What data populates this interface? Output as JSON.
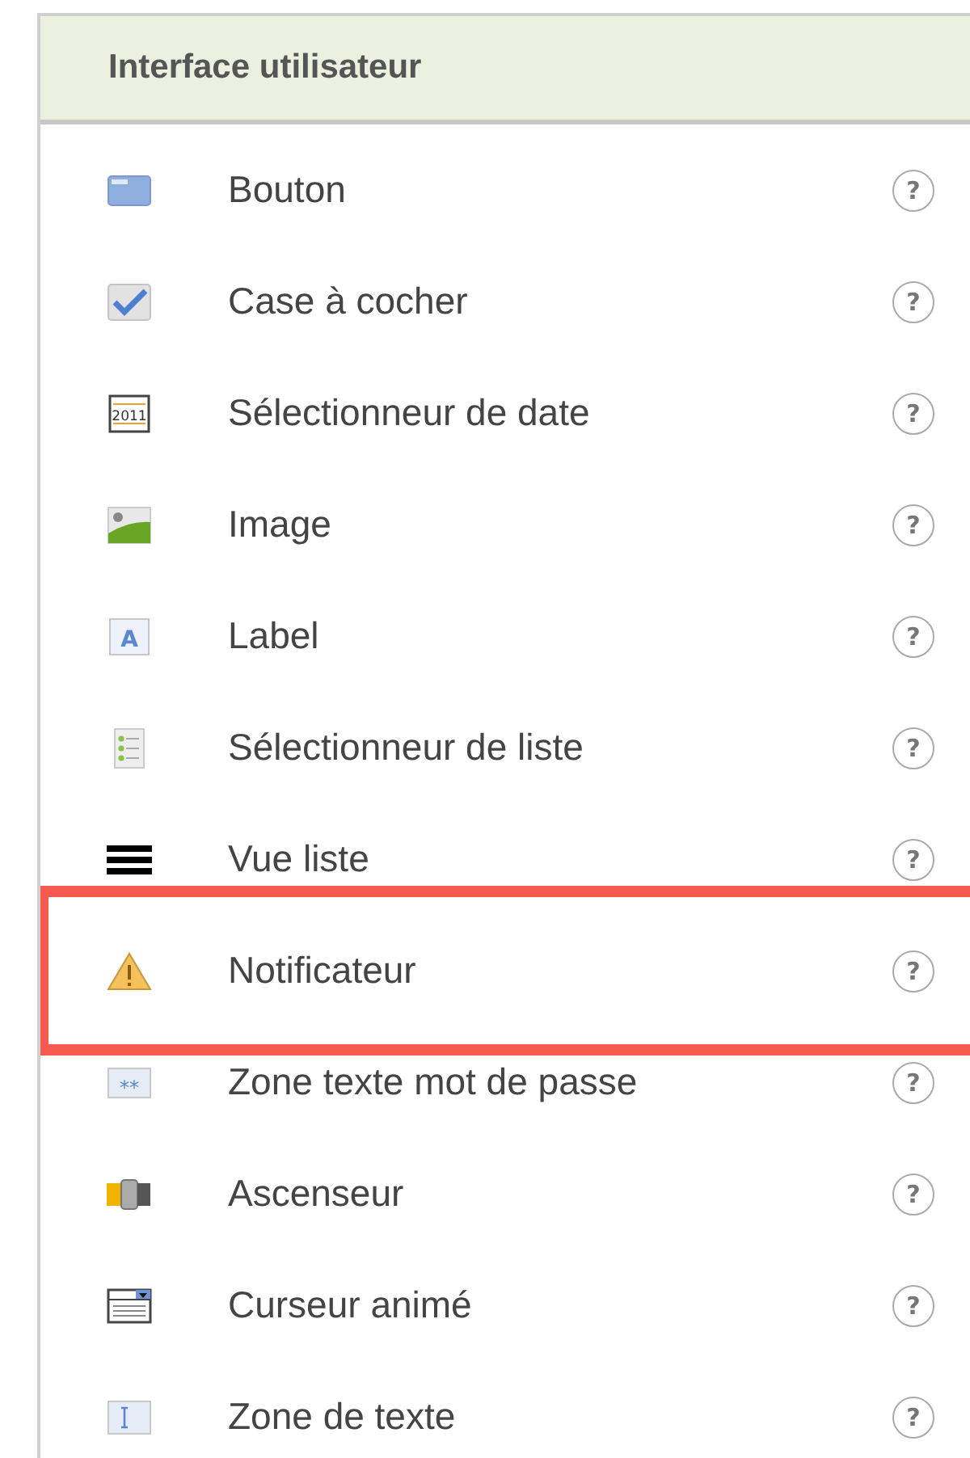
{
  "panel": {
    "title": "Interface utilisateur"
  },
  "items": [
    {
      "kind": "button",
      "label": "Bouton",
      "help": "?",
      "highlighted": false
    },
    {
      "kind": "checkbox",
      "label": "Case à cocher",
      "help": "?",
      "highlighted": false
    },
    {
      "kind": "datepicker",
      "label": "Sélectionneur de date",
      "help": "?",
      "highlighted": false,
      "icon_text": "2011"
    },
    {
      "kind": "image",
      "label": "Image",
      "help": "?",
      "highlighted": false
    },
    {
      "kind": "label",
      "label": "Label",
      "help": "?",
      "highlighted": false,
      "icon_text": "A"
    },
    {
      "kind": "listpicker",
      "label": "Sélectionneur de liste",
      "help": "?",
      "highlighted": false
    },
    {
      "kind": "listview",
      "label": "Vue liste",
      "help": "?",
      "highlighted": false
    },
    {
      "kind": "notifier",
      "label": "Notificateur",
      "help": "?",
      "highlighted": true
    },
    {
      "kind": "password",
      "label": "Zone texte mot de passe",
      "help": "?",
      "highlighted": false,
      "icon_text": "**"
    },
    {
      "kind": "slider",
      "label": "Ascenseur",
      "help": "?",
      "highlighted": false
    },
    {
      "kind": "spinner",
      "label": "Curseur animé",
      "help": "?",
      "highlighted": false
    },
    {
      "kind": "textbox",
      "label": "Zone de texte",
      "help": "?",
      "highlighted": false
    }
  ]
}
